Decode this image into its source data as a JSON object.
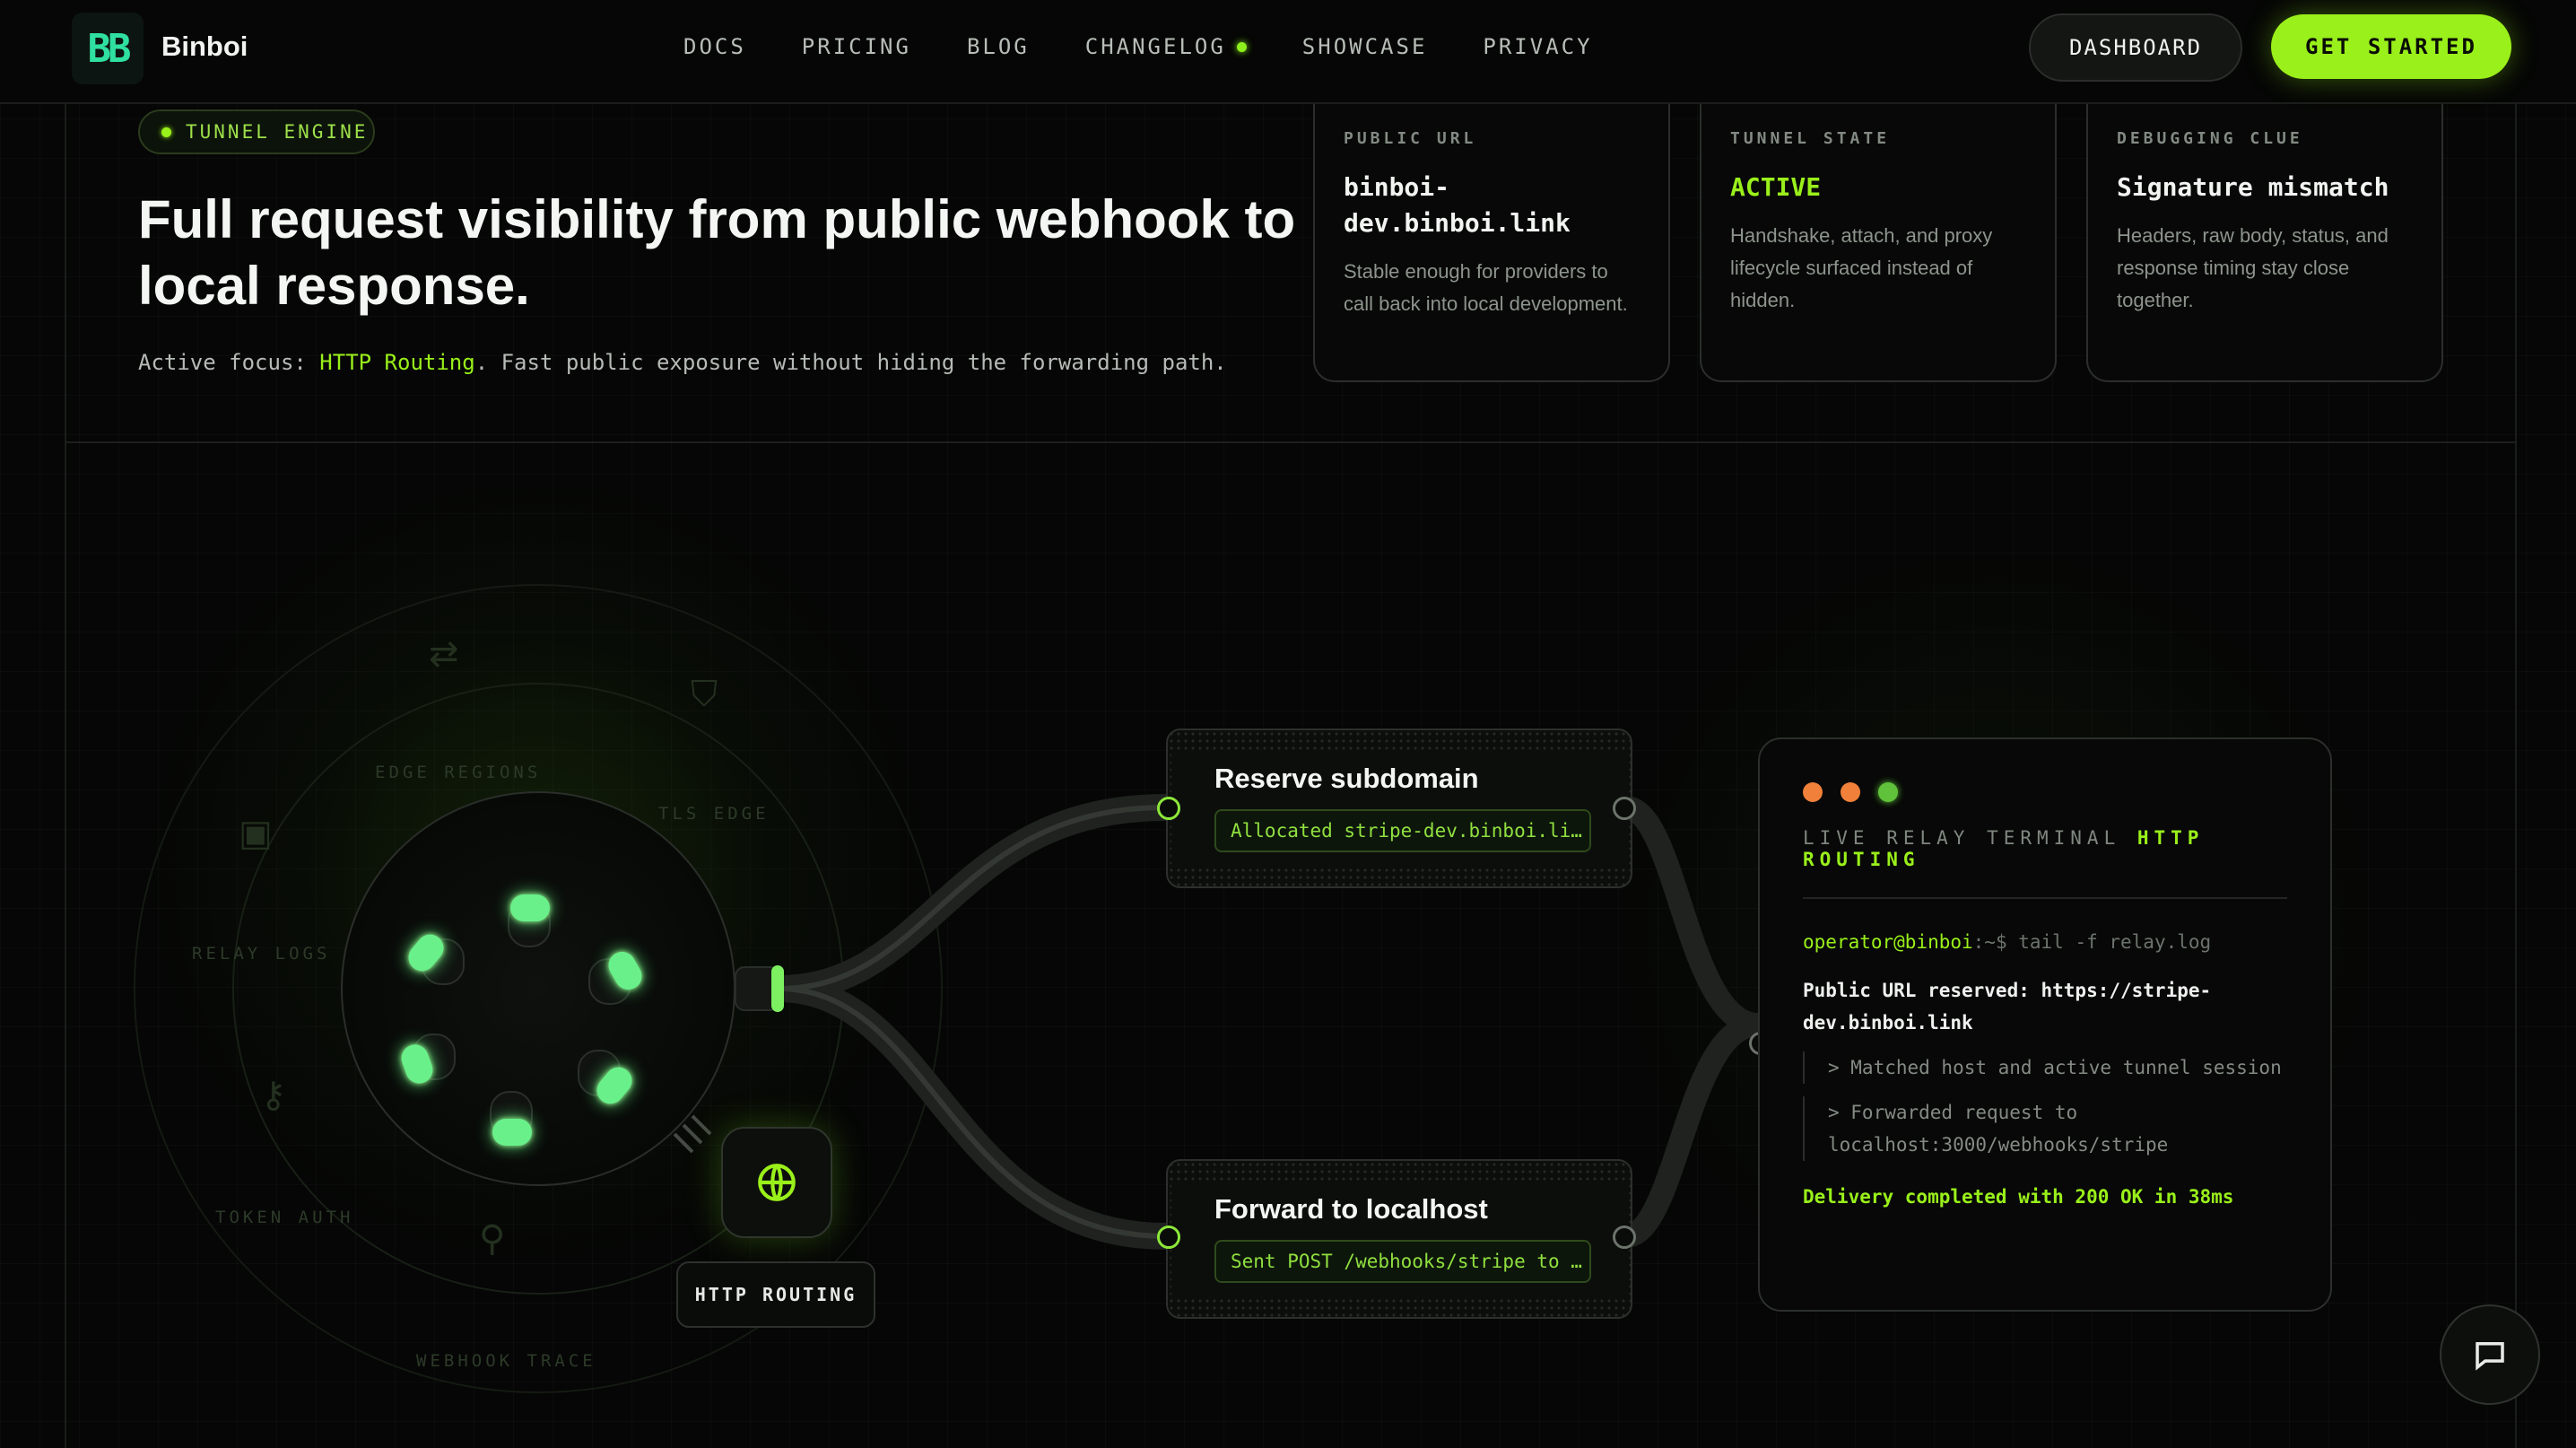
{
  "nav": {
    "logo_mark": "BB",
    "brand": "Binboi",
    "links": [
      {
        "label": "DOCS"
      },
      {
        "label": "PRICING"
      },
      {
        "label": "BLOG"
      },
      {
        "label": "CHANGELOG"
      },
      {
        "label": "SHOWCASE"
      },
      {
        "label": "PRIVACY"
      }
    ],
    "dashboard_label": "DASHBOARD",
    "get_started_label": "GET STARTED"
  },
  "hero": {
    "badge": "TUNNEL ENGINE",
    "title": "Full request visibility from public webhook to local response.",
    "sub_prefix": "Active focus: ",
    "sub_focus": "HTTP Routing",
    "sub_suffix": ". Fast public exposure without hiding the forwarding path."
  },
  "cards": [
    {
      "label": "PUBLIC URL",
      "value": "binboi-dev.binboi.link",
      "desc": "Stable enough for providers to call back into local development."
    },
    {
      "label": "TUNNEL STATE",
      "value": "ACTIVE",
      "desc": "Handshake, attach, and proxy lifecycle surfaced instead of hidden."
    },
    {
      "label": "DEBUGGING CLUE",
      "value": "Signature mismatch",
      "desc": "Headers, raw body, status, and response timing stay close together."
    }
  ],
  "ring_labels": {
    "edge_regions": "EDGE REGIONS",
    "tls_edge": "TLS EDGE",
    "relay_logs": "RELAY LOGS",
    "token_auth": "TOKEN AUTH",
    "webhook_trace": "WEBHOOK TRACE"
  },
  "http_routing_label": "HTTP ROUTING",
  "flow": {
    "reserve": {
      "title": "Reserve subdomain",
      "chip": "Allocated stripe-dev.binboi.li…"
    },
    "forward": {
      "title": "Forward to localhost",
      "chip": "Sent POST /webhooks/stripe to …"
    }
  },
  "terminal": {
    "header_prefix": "LIVE RELAY TERMINAL",
    "header_mode": "HTTP ROUTING",
    "prompt_user": "operator@binboi",
    "prompt_cmd": ":~$ tail -f relay.log",
    "line_reserved": "Public URL reserved: https://stripe-dev.binboi.link",
    "line_matched": "> Matched host and active tunnel session",
    "line_forwarded": "> Forwarded request to localhost:3000/webhooks/stripe",
    "line_ok": "Delivery completed with 200 OK in 38ms",
    "dot_colors": [
      "#f0803a",
      "#f0803a",
      "#5fc23a"
    ]
  },
  "colors": {
    "accent": "#9af01a",
    "background": "#050605"
  }
}
